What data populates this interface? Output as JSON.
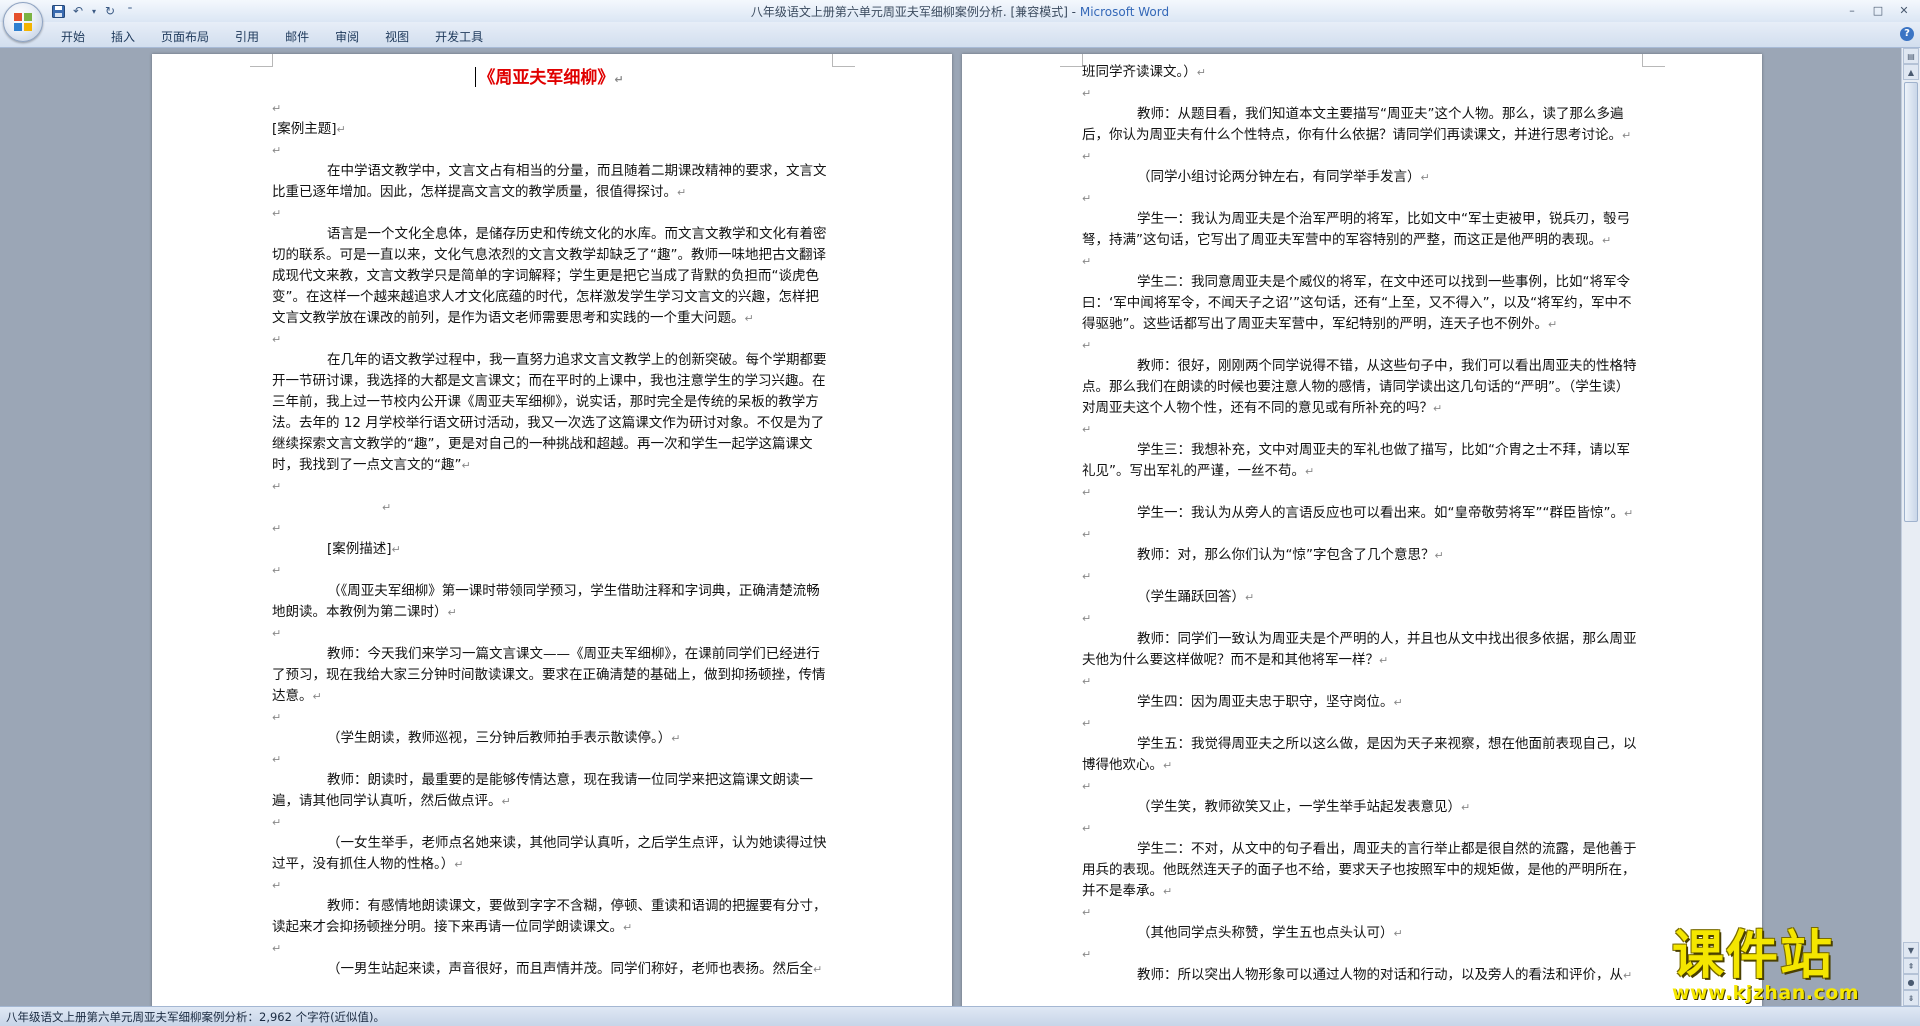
{
  "window": {
    "title": "八年级语文上册第六单元周亚夫军细柳案例分析. [兼容模式] - ",
    "app_name": "Microsoft Word"
  },
  "quick_access": [
    "save-icon",
    "undo-icon",
    "redo-icon",
    "customize-icon"
  ],
  "ribbon": {
    "tabs": [
      "开始",
      "插入",
      "页面布局",
      "引用",
      "邮件",
      "审阅",
      "视图",
      "开发工具"
    ]
  },
  "page1": {
    "title": "《周亚夫军细柳》",
    "paragraphs": [
      {
        "type": "blank"
      },
      {
        "type": "text",
        "indent": false,
        "text": "[案例主题]"
      },
      {
        "type": "blank"
      },
      {
        "type": "text",
        "indent": true,
        "text": "在中学语文教学中，文言文占有相当的分量，而且随着二期课改精神的要求，文言文比重已逐年增加。因此，怎样提高文言文的教学质量，很值得探讨。"
      },
      {
        "type": "blank"
      },
      {
        "type": "text",
        "indent": true,
        "text": "语言是一个文化全息体，是储存历史和传统文化的水库。而文言文教学和文化有着密切的联系。可是一直以来，文化气息浓烈的文言文教学却缺乏了“趣”。教师一味地把古文翻译成现代文来教，文言文教学只是简单的字词解释；学生更是把它当成了背默的负担而“谈虎色变”。在这样一个越来越追求人才文化底蕴的时代，怎样激发学生学习文言文的兴趣，怎样把文言文教学放在课改的前列，是作为语文老师需要思考和实践的一个重大问题。"
      },
      {
        "type": "blank"
      },
      {
        "type": "text",
        "indent": true,
        "text": "在几年的语文教学过程中，我一直努力追求文言文教学上的创新突破。每个学期都要开一节研讨课，我选择的大都是文言课文；而在平时的上课中，我也注意学生的学习兴趣。在三年前，我上过一节校内公开课《周亚夫军细柳》，说实话，那时完全是传统的呆板的教学方法。去年的 12 月学校举行语文研讨活动，我又一次选了这篇课文作为研讨对象。不仅是为了继续探索文言文教学的“趣”，更是对自己的一种挑战和超越。再一次和学生一起学这篇课文时，我找到了一点文言文的“趣”"
      },
      {
        "type": "blank"
      },
      {
        "type": "blank-indent"
      },
      {
        "type": "blank"
      },
      {
        "type": "text",
        "indent": true,
        "text": "[案例描述]"
      },
      {
        "type": "blank"
      },
      {
        "type": "text",
        "indent": true,
        "text": "（《周亚夫军细柳》第一课时带领同学预习，学生借助注释和字词典，正确清楚流畅地朗读。本教例为第二课时）"
      },
      {
        "type": "blank"
      },
      {
        "type": "text",
        "indent": true,
        "text": "教师：今天我们来学习一篇文言课文——《周亚夫军细柳》，在课前同学们已经进行了预习，现在我给大家三分钟时间散读课文。要求在正确清楚的基础上，做到抑扬顿挫，传情达意。"
      },
      {
        "type": "blank"
      },
      {
        "type": "text",
        "indent": true,
        "text": "（学生朗读，教师巡视，三分钟后教师拍手表示散读停。）"
      },
      {
        "type": "blank"
      },
      {
        "type": "text",
        "indent": true,
        "text": "教师：朗读时，最重要的是能够传情达意，现在我请一位同学来把这篇课文朗读一遍，请其他同学认真听，然后做点评。"
      },
      {
        "type": "blank"
      },
      {
        "type": "text",
        "indent": true,
        "text": "（一女生举手，老师点名她来读，其他同学认真听，之后学生点评，认为她读得过快过平，没有抓住人物的性格。）"
      },
      {
        "type": "blank"
      },
      {
        "type": "text",
        "indent": true,
        "text": "教师：有感情地朗读课文，要做到字字不含糊，停顿、重读和语调的把握要有分寸，读起来才会抑扬顿挫分明。接下来再请一位同学朗读课文。"
      },
      {
        "type": "blank"
      },
      {
        "type": "text",
        "indent": true,
        "text": "（一男生站起来读，声音很好，而且声情并茂。同学们称好，老师也表扬。然后全"
      }
    ]
  },
  "page2": {
    "paragraphs": [
      {
        "type": "text",
        "indent": false,
        "text": "班同学齐读课文。）"
      },
      {
        "type": "blank"
      },
      {
        "type": "text",
        "indent": true,
        "text": "教师：从题目看，我们知道本文主要描写“周亚夫”这个人物。那么，读了那么多遍后，你认为周亚夫有什么个性特点，你有什么依据？请同学们再读课文，并进行思考讨论。"
      },
      {
        "type": "blank"
      },
      {
        "type": "text",
        "indent": true,
        "text": "（同学小组讨论两分钟左右，有同学举手发言）"
      },
      {
        "type": "blank"
      },
      {
        "type": "text",
        "indent": true,
        "text": "学生一：我认为周亚夫是个治军严明的将军，比如文中“军士吏被甲，锐兵刃，彀弓弩，持满”这句话，它写出了周亚夫军营中的军容特别的严整，而这正是他严明的表现。"
      },
      {
        "type": "blank"
      },
      {
        "type": "text",
        "indent": true,
        "text": "学生二：我同意周亚夫是个威仪的将军，在文中还可以找到一些事例，比如“将军令曰：‘军中闻将军令，不闻天子之诏’”这句话，还有“上至，又不得入”，以及“将军约，军中不得驱驰”。这些话都写出了周亚夫军营中，军纪特别的严明，连天子也不例外。"
      },
      {
        "type": "blank"
      },
      {
        "type": "text",
        "indent": true,
        "text": "教师：很好，刚刚两个同学说得不错，从这些句子中，我们可以看出周亚夫的性格特点。那么我们在朗读的时候也要注意人物的感情，请同学读出这几句话的“严明”。（学生读）对周亚夫这个人物个性，还有不同的意见或有所补充的吗？"
      },
      {
        "type": "blank"
      },
      {
        "type": "text",
        "indent": true,
        "text": "学生三：我想补充，文中对周亚夫的军礼也做了描写，比如“介胄之士不拜，请以军礼见”。写出军礼的严谨，一丝不苟。"
      },
      {
        "type": "blank"
      },
      {
        "type": "text",
        "indent": true,
        "text": "学生一：我认为从旁人的言语反应也可以看出来。如“皇帝敬劳将军”“群臣皆惊”。"
      },
      {
        "type": "blank"
      },
      {
        "type": "text",
        "indent": true,
        "text": "教师：对，那么你们认为“惊”字包含了几个意思？"
      },
      {
        "type": "blank"
      },
      {
        "type": "text",
        "indent": true,
        "text": "（学生踊跃回答）"
      },
      {
        "type": "blank"
      },
      {
        "type": "text",
        "indent": true,
        "text": "教师：同学们一致认为周亚夫是个严明的人，并且也从文中找出很多依据，那么周亚夫他为什么要这样做呢？而不是和其他将军一样？"
      },
      {
        "type": "blank"
      },
      {
        "type": "text",
        "indent": true,
        "text": "学生四：因为周亚夫忠于职守，坚守岗位。"
      },
      {
        "type": "blank"
      },
      {
        "type": "text",
        "indent": true,
        "text": "学生五：我觉得周亚夫之所以这么做，是因为天子来视察，想在他面前表现自己，以博得他欢心。"
      },
      {
        "type": "blank"
      },
      {
        "type": "text",
        "indent": true,
        "text": "（学生笑，教师欲笑又止，一学生举手站起发表意见）"
      },
      {
        "type": "blank"
      },
      {
        "type": "text",
        "indent": true,
        "text": "学生二：不对，从文中的句子看出，周亚夫的言行举止都是很自然的流露，是他善于用兵的表现。他既然连天子的面子也不给，要求天子也按照军中的规矩做，是他的严明所在，并不是奉承。"
      },
      {
        "type": "blank"
      },
      {
        "type": "text",
        "indent": true,
        "text": "（其他同学点头称赞，学生五也点头认可）"
      },
      {
        "type": "blank"
      },
      {
        "type": "text",
        "indent": true,
        "text": "教师：所以突出人物形象可以通过人物的对话和行动，以及旁人的看法和评价，从"
      }
    ]
  },
  "status_bar": {
    "text": "八年级语文上册第六单元周亚夫军细柳案例分析：2,962 个字符(近似值)。"
  },
  "watermark": {
    "title": "课件站",
    "url": "www.kjzhan.com"
  },
  "colors": {
    "title_red": "#e00000",
    "ribbon_bg": "#d2deee",
    "doc_bg": "#9ba6b6",
    "watermark_yellow": "#f4e600"
  }
}
